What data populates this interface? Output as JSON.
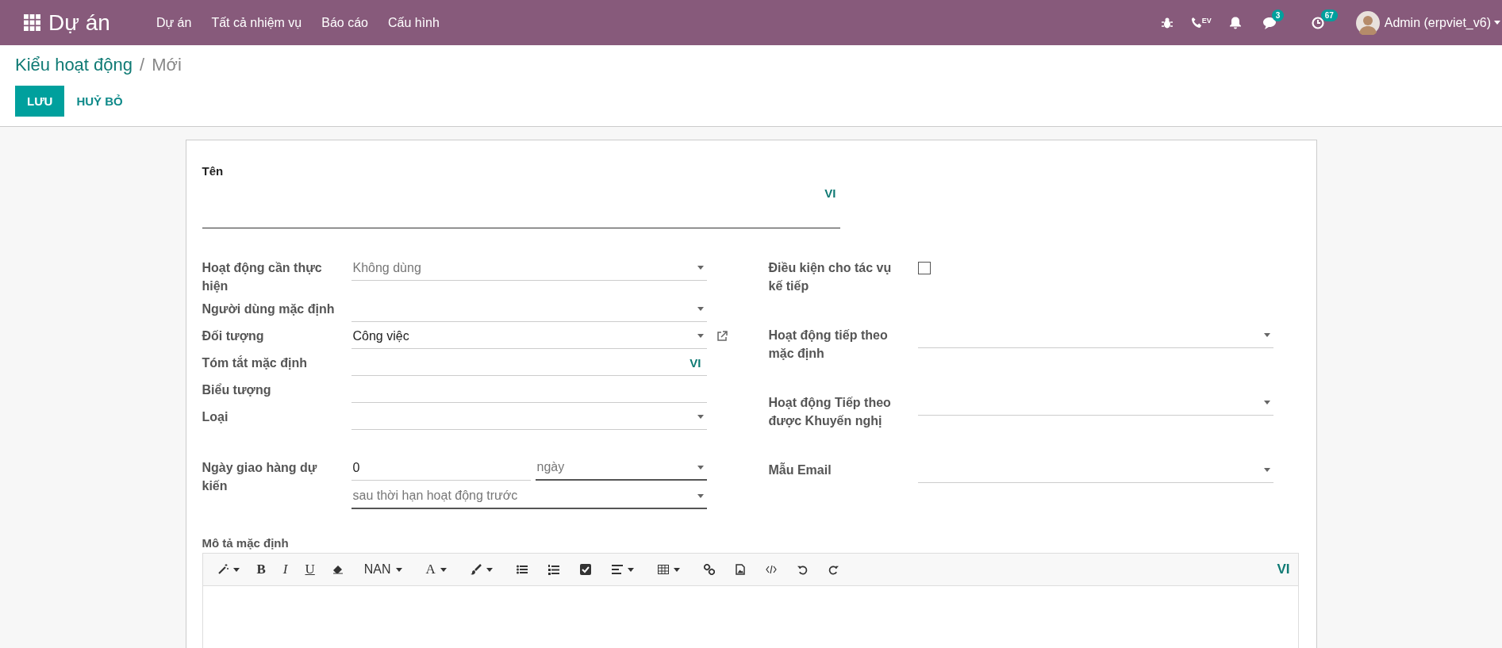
{
  "topbar": {
    "app_name": "Dự án",
    "menu": [
      "Dự án",
      "Tất cả nhiệm vụ",
      "Báo cáo",
      "Cấu hình"
    ],
    "phone_label": "EV",
    "messages_count": "3",
    "activities_count": "67",
    "user": "Admin (erpviet_v6)"
  },
  "breadcrumb": {
    "parent": "Kiểu hoạt động",
    "separator": "/",
    "current": "Mới"
  },
  "buttons": [
    {
      "label": "LƯU",
      "kind": "primary"
    },
    {
      "label": "HUỶ BỎ",
      "kind": "link"
    }
  ],
  "form": {
    "name": {
      "label": "Tên",
      "lang": "VI"
    },
    "left_fields": [
      {
        "label": "Hoạt động cần thực hiện",
        "kind": "selection",
        "value": "Không dùng"
      },
      {
        "label": "Người dùng mặc định",
        "kind": "many2one"
      },
      {
        "label": "Đối tượng",
        "kind": "many2one",
        "value": "Công việc",
        "open_link": true
      },
      {
        "label": "Tóm tắt mặc định",
        "kind": "translatable",
        "lang": "VI"
      },
      {
        "label": "Biểu tượng",
        "kind": "text"
      },
      {
        "label": "Loại",
        "kind": "selection"
      }
    ],
    "delay": {
      "label": "Ngày giao hàng dự kiến",
      "number": "0",
      "unit": "ngày",
      "from": "sau thời hạn hoạt động trước"
    },
    "right_fields": [
      {
        "label": "Điều kiện cho tác vụ kế tiếp",
        "kind": "checkbox",
        "checked": false
      },
      {
        "label": "Hoạt động tiếp theo mặc định",
        "kind": "many2one"
      },
      {
        "label": "Hoạt động Tiếp theo được Khuyến nghị",
        "kind": "many2one"
      },
      {
        "label": "Mẫu Email",
        "kind": "many2one"
      }
    ],
    "description": {
      "label": "Mô tả mặc định",
      "toolbar_labels": [
        "B",
        "I",
        "U",
        "NAN",
        "A"
      ],
      "lang": "VI"
    }
  }
}
